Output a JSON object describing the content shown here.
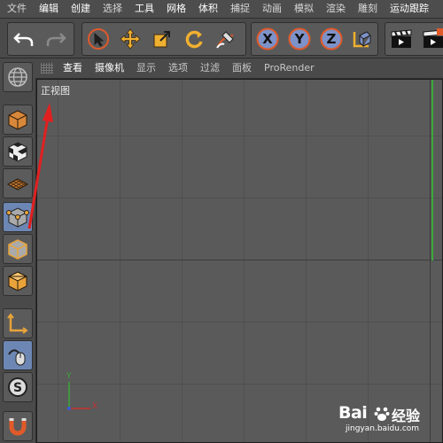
{
  "menubar": {
    "items": [
      "文件",
      "编辑",
      "创建",
      "选择",
      "工具",
      "网格",
      "体积",
      "捕捉",
      "动画",
      "模拟",
      "渲染",
      "雕刻",
      "运动跟踪"
    ]
  },
  "toolbar": {
    "undo_label": "undo",
    "axis_x": "X",
    "axis_y": "Y",
    "axis_z": "Z"
  },
  "viewmenu": {
    "items": [
      "查看",
      "摄像机",
      "显示",
      "选项",
      "过滤",
      "面板",
      "ProRender"
    ]
  },
  "viewport": {
    "label": "正视图",
    "axis_x_label": "X",
    "axis_y_label": "Y"
  },
  "watermark": {
    "brand": "Bai",
    "brand2": "经验",
    "url": "jingyan.baidu.com"
  },
  "colors": {
    "accent_orange": "#e8a33a",
    "arrow_red": "#e02020",
    "axis_red": "#c83030",
    "axis_green": "#3ca83c",
    "axis_blue": "#3c5ad0"
  }
}
